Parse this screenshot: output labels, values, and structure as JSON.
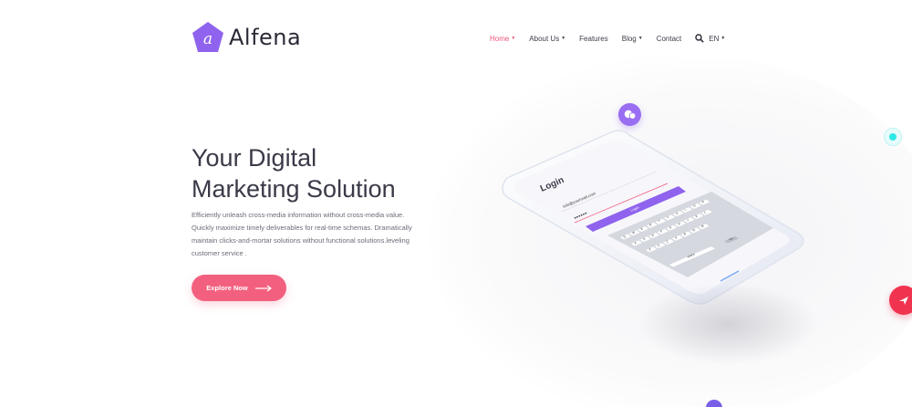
{
  "brand": {
    "name": "Alfena",
    "logo_letter": "a",
    "colors": {
      "primary_pink": "#f3607f",
      "purple": "#8f63ee",
      "active_nav": "#f2557a",
      "cyan": "#2de8e8",
      "red": "#f0344f"
    }
  },
  "nav": {
    "items": [
      {
        "label": "Home",
        "has_dropdown": true,
        "active": true
      },
      {
        "label": "About Us",
        "has_dropdown": true,
        "active": false
      },
      {
        "label": "Features",
        "has_dropdown": false,
        "active": false
      },
      {
        "label": "Blog",
        "has_dropdown": true,
        "active": false
      },
      {
        "label": "Contact",
        "has_dropdown": false,
        "active": false
      }
    ],
    "search_icon": "search-icon",
    "language": "EN"
  },
  "hero": {
    "title_line1": "Your Digital",
    "title_line2": "Marketing Solution",
    "description": "Efficiently unleash cross-media information without cross-media value. Quickly maximize timely deliverables for real-time schemas. Dramatically maintain clicks-and-mortar solutions without functional solutions.leveling customer service .",
    "cta_label": "Explore Now",
    "cta_icon": "arrow-right-icon"
  },
  "phone_screen": {
    "title": "Login",
    "email_value": "info@yourmail.com",
    "button_label": "Login",
    "keyboard_rows": [
      [
        "Q",
        "W",
        "E",
        "R",
        "T",
        "Y",
        "U",
        "I",
        "O",
        "P"
      ],
      [
        "A",
        "S",
        "D",
        "F",
        "G",
        "H",
        "J",
        "K",
        "L"
      ],
      [
        "Z",
        "X",
        "C",
        "V",
        "B",
        "N",
        "M"
      ]
    ],
    "space_label": "space",
    "go_label": "Go"
  }
}
